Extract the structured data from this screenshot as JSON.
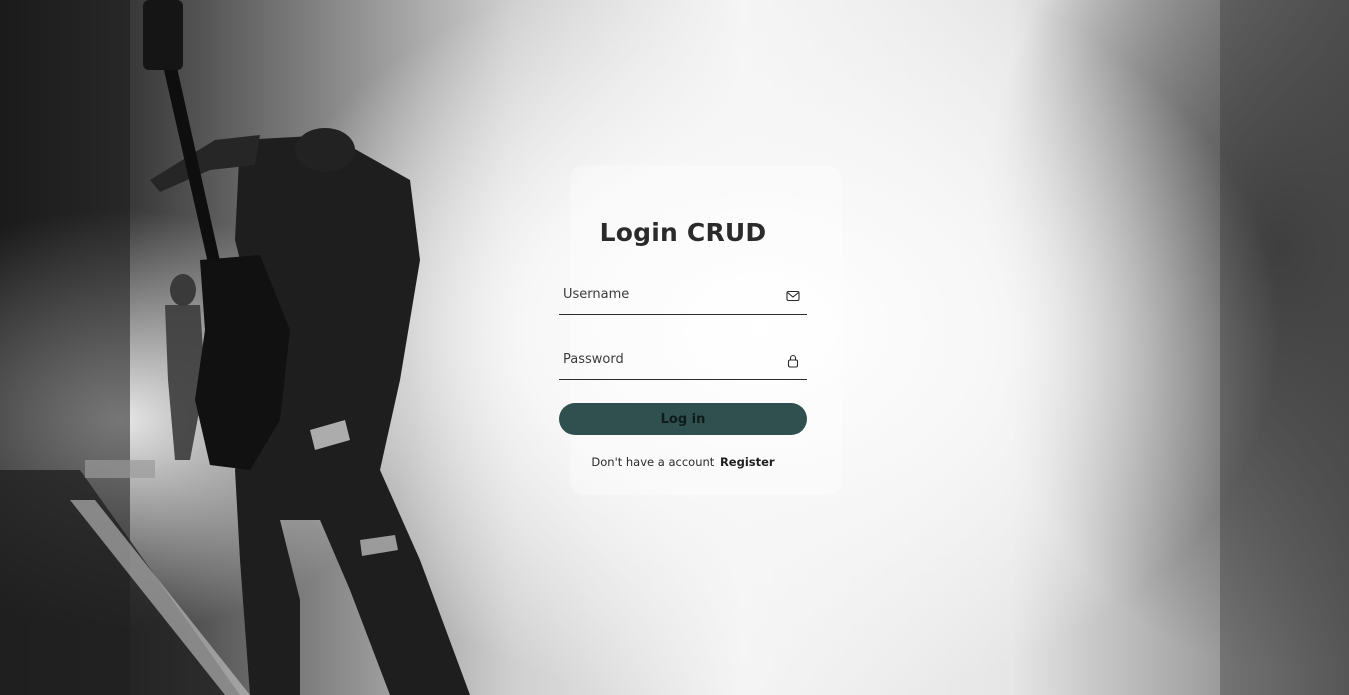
{
  "login": {
    "title": "Login CRUD",
    "username": {
      "placeholder": "Username",
      "value": "",
      "icon": "mail-icon"
    },
    "password": {
      "placeholder": "Password",
      "value": "",
      "icon": "lock-icon"
    },
    "submit_label": "Log in",
    "register_prompt": "Don't have a account",
    "register_link": "Register"
  },
  "colors": {
    "button": "#2f504e",
    "text": "#2b2b2b"
  }
}
